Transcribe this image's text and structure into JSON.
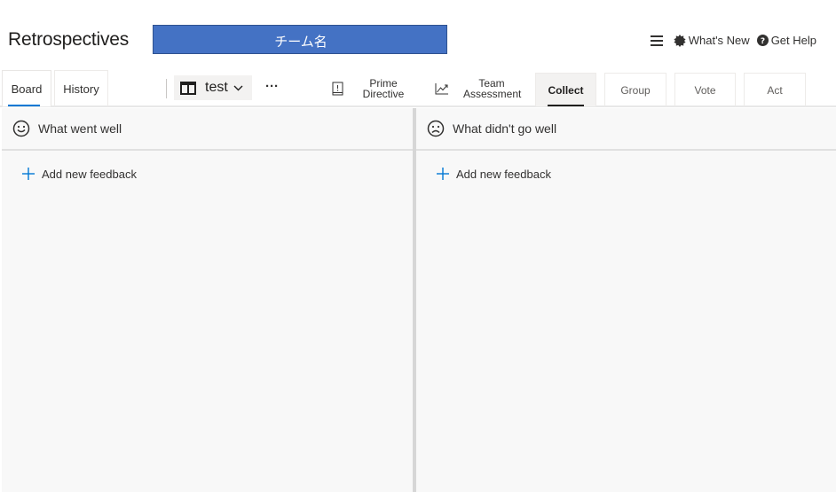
{
  "header": {
    "app_title": "Retrospectives",
    "team_name": "チーム名",
    "whats_new": "What's New",
    "get_help": "Get Help"
  },
  "tabs": {
    "board": "Board",
    "history": "History"
  },
  "board_selector": {
    "value": "test"
  },
  "tools": {
    "more": "···",
    "prime_line1": "Prime",
    "prime_line2": "Directive",
    "team_line1": "Team",
    "team_line2": "Assessment"
  },
  "phases": {
    "collect": "Collect",
    "group": "Group",
    "vote": "Vote",
    "act": "Act"
  },
  "columns": [
    {
      "title": "What went well",
      "add_label": "Add new feedback"
    },
    {
      "title": "What didn't go well",
      "add_label": "Add new feedback"
    }
  ],
  "colors": {
    "accent": "#0078d4",
    "team_bar": "#4472c4"
  }
}
